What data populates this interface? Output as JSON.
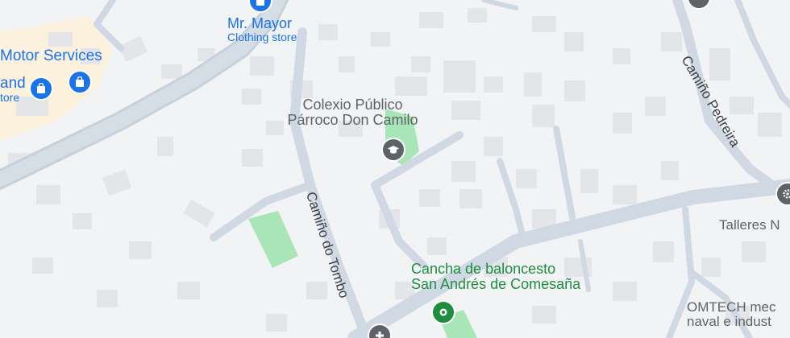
{
  "colors": {
    "background": "#f1f3f4",
    "building": "#e3e5e8",
    "road": "#cfd8e3",
    "main_road": "#c7d1dc",
    "park": "#a8e6b8",
    "shopping_pin": "#1a73e8",
    "education_pin": "#5f6368",
    "sport_pin": "#1e8e3e"
  },
  "pois": {
    "mr_mayor": {
      "name": "Mr. Mayor",
      "category": "Clothing store",
      "icon": "shopping-bag-icon"
    },
    "motor_services": {
      "name": "Motor Services",
      "icon": "shopping-bag-icon"
    },
    "partial_store_left": {
      "name": "and",
      "category": "tore",
      "icon": "shopping-bag-icon"
    },
    "colexio": {
      "line1": "Colexio Público",
      "line2": "Párroco Don Camilo",
      "icon": "school-icon"
    },
    "cancha": {
      "line1": "Cancha de baloncesto",
      "line2": "San Andrés de Comesaña",
      "icon": "basketball-pin-icon"
    },
    "talleres": {
      "name": "Talleres N",
      "icon": "gear-icon"
    },
    "omtech": {
      "line1": "OMTECH mec",
      "line2": "naval e indust",
      "icon": "service-icon"
    }
  },
  "roads": {
    "camino_tombo": "Camiño do Tombo",
    "camino_pedreira": "Camiño Pedreira"
  }
}
